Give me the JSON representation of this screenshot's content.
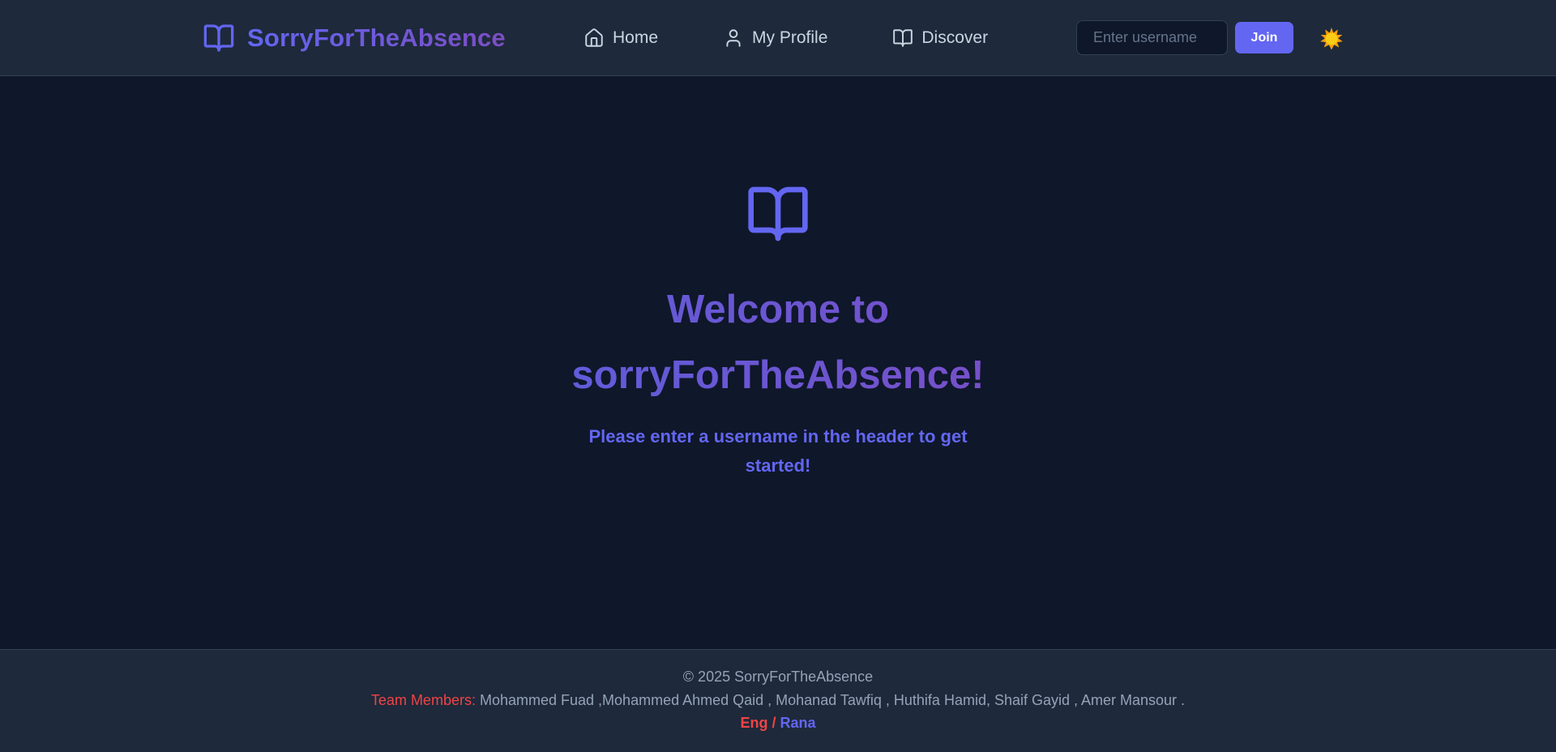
{
  "header": {
    "brand": "SorryForTheAbsence",
    "brand_icon": "open-book-icon",
    "nav": [
      {
        "label": "Home",
        "icon": "home-icon"
      },
      {
        "label": "My Profile",
        "icon": "user-icon"
      },
      {
        "label": "Discover",
        "icon": "open-book-icon"
      }
    ],
    "username_placeholder": "Enter username",
    "username_value": "",
    "join_label": "Join",
    "theme_icon": "sun-icon"
  },
  "hero": {
    "icon": "open-book-icon",
    "title_line1": "Welcome to",
    "title_line2": "sorryForTheAbsence!",
    "subtitle": "Please enter a username in the header to get started!"
  },
  "footer": {
    "copyright": "© 2025 SorryForTheAbsence",
    "team_label": "Team Members:",
    "team_members": "Mohammed Fuad ,Mohammed Ahmed Qaid , Mohanad Tawfiq , Huthifa Hamid, Shaif Gayid , Amer Mansour .",
    "credit_prefix": "Eng /",
    "credit_name": "Rana"
  },
  "colors": {
    "background": "#0f172a",
    "header_bg": "#1e293b",
    "accent": "#6366f1",
    "accent_purple": "#7c4dc4",
    "highlight_red": "#ef4444",
    "sun": "#facc15"
  }
}
